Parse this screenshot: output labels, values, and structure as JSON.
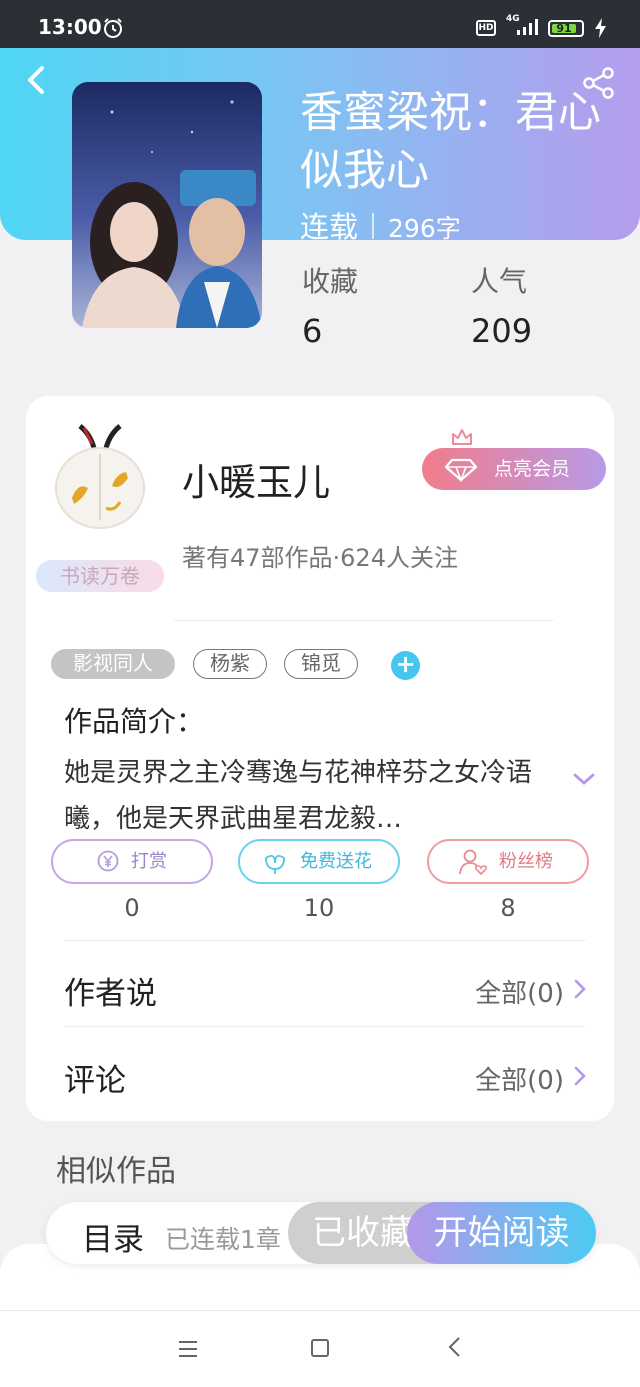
{
  "status_bar": {
    "time": "13:00",
    "hd": "HD",
    "network": "4G",
    "battery": "91"
  },
  "book": {
    "title": "香蜜梁祝：君心似我心",
    "status": "连载",
    "word_count": "296字",
    "stats": {
      "favorites_label": "收藏",
      "favorites_value": "6",
      "popularity_label": "人气",
      "popularity_value": "209"
    }
  },
  "author": {
    "name": "小暖玉儿",
    "badge": "书读万卷",
    "meta": "著有47部作品·624人关注",
    "vip_button": "点亮会员"
  },
  "tags": [
    "影视同人",
    "杨紫",
    "锦觅"
  ],
  "synopsis": {
    "title": "作品简介：",
    "text": "她是灵界之主冷骞逸与花神梓芬之女冷语曦，他是天界武曲星君龙毅…"
  },
  "actions": [
    {
      "label": "打赏",
      "count": "0",
      "icon": "yen-icon"
    },
    {
      "label": "免费送花",
      "count": "10",
      "icon": "flower-icon"
    },
    {
      "label": "粉丝榜",
      "count": "8",
      "icon": "fan-rank-icon"
    }
  ],
  "rows": [
    {
      "label": "作者说",
      "value": "全部(0)"
    },
    {
      "label": "评论",
      "value": "全部(0)"
    }
  ],
  "similar_title": "相似作品",
  "bottom_bar": {
    "toc_label": "目录",
    "toc_meta": "已连载1章",
    "collected_label": "已收藏",
    "read_label": "开始阅读"
  },
  "colors": {
    "header_gradient": [
      "#4fd6f4",
      "#b69cee"
    ],
    "read_button_gradient": [
      "#b597ea",
      "#4ccaf3"
    ],
    "accent_purple": "#b597ea",
    "accent_cyan": "#45c6ef"
  }
}
